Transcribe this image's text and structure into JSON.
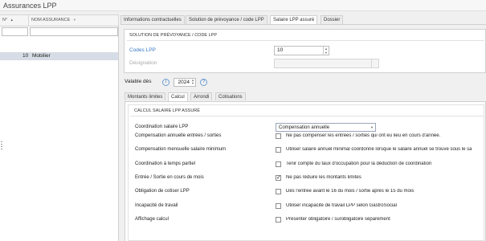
{
  "app": {
    "title": "Assurances LPP"
  },
  "list": {
    "columns": [
      {
        "label": "N°",
        "sort": "▲"
      },
      {
        "label": "NOM ASSURANCE",
        "sort": "▼"
      }
    ],
    "rows": [
      {
        "number": "10",
        "name": "Mobilier"
      }
    ]
  },
  "tabs": [
    {
      "label": "Informations contractuelles"
    },
    {
      "label": "Solution de prévoyance / code LPP"
    },
    {
      "label": "Salaire LPP assuré",
      "active": true
    },
    {
      "label": "Dossier"
    }
  ],
  "solution": {
    "title": "SOLUTION DE PRÉVOYANCE / CODE LPP",
    "codes_label": "Codes LPP",
    "codes_value": "10",
    "designation_label": "Désignation",
    "designation_value": ""
  },
  "validity": {
    "label": "Valable dès",
    "year": "2024",
    "info_icon": "i",
    "next_icon": "?"
  },
  "subtabs": [
    {
      "label": "Montants limites"
    },
    {
      "label": "Calcul",
      "active": true
    },
    {
      "label": "Arrondi"
    },
    {
      "label": "Cotisations"
    }
  ],
  "calc": {
    "title": "CALCUL SALAIRE LPP ASSURÉ",
    "coordination_label": "Coordination salaire LPP",
    "coordination_value": "Compensation annuelle",
    "rows": [
      {
        "label": "Compensation annuelle entrées / sorties",
        "text": "Ne pas compenser les entrées / sorties qui ont eu lieu en cours d'année.",
        "checked": false
      },
      {
        "label": "Compensation mensuelle salaire minimum",
        "text": "Utiliser salaire annuel minimal coordonné lorsque le salaire annuel se trouve sous le sa",
        "checked": false
      },
      {
        "label": "Coordination à temps partiel",
        "text": "Tenir compte du taux d'occupation pour la déduction de coordination",
        "checked": false
      },
      {
        "label": "Entrée / Sortie en cours de mois",
        "text": "Ne pas réduire les montants limites",
        "checked": true
      },
      {
        "label": "Obligation de cotiser LPP",
        "text": "Dès l'entrée avant le 16 du mois / sortie après le 15 du mois",
        "checked": false
      },
      {
        "label": "Incapacité de travail",
        "text": "Utiliser incapacité de travail LPP selon GastroSocial",
        "checked": false
      },
      {
        "label": "Affichage calcul",
        "text": "Présenter obligatoire / surobligatoire séparément",
        "checked": false
      }
    ]
  }
}
